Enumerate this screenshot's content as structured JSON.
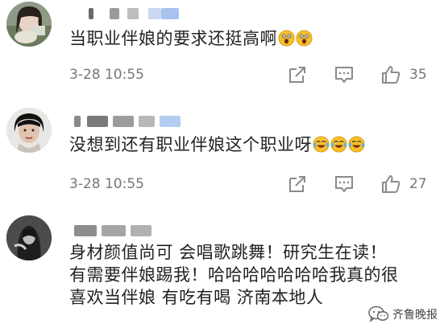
{
  "comments": [
    {
      "text": "当职业伴娘的要求还挺高啊",
      "emoji": [
        "scream-emoji",
        "scream-emoji"
      ],
      "timestamp": "3-28 10:55",
      "likes": "35"
    },
    {
      "text": "没想到还有职业伴娘这个职业呀",
      "emoji": [
        "laugh-cry-emoji",
        "laugh-cry-emoji",
        "laugh-cry-emoji"
      ],
      "timestamp": "3-28 10:55",
      "likes": "27"
    },
    {
      "lines": [
        "身材颜值尚可 会唱歌跳舞！研究生在读！",
        "有需要伴娘踢我！哈哈哈哈哈哈哈我真的很",
        "喜欢当伴娘 有吃有喝 济南本地人"
      ]
    }
  ],
  "watermark": {
    "text": "齐鲁晚报",
    "icon": "wechat-icon"
  },
  "colors": {
    "text": "#222222",
    "meta": "#777777",
    "icon": "#8a8a8a",
    "emoji_face": "#f7c12c"
  }
}
